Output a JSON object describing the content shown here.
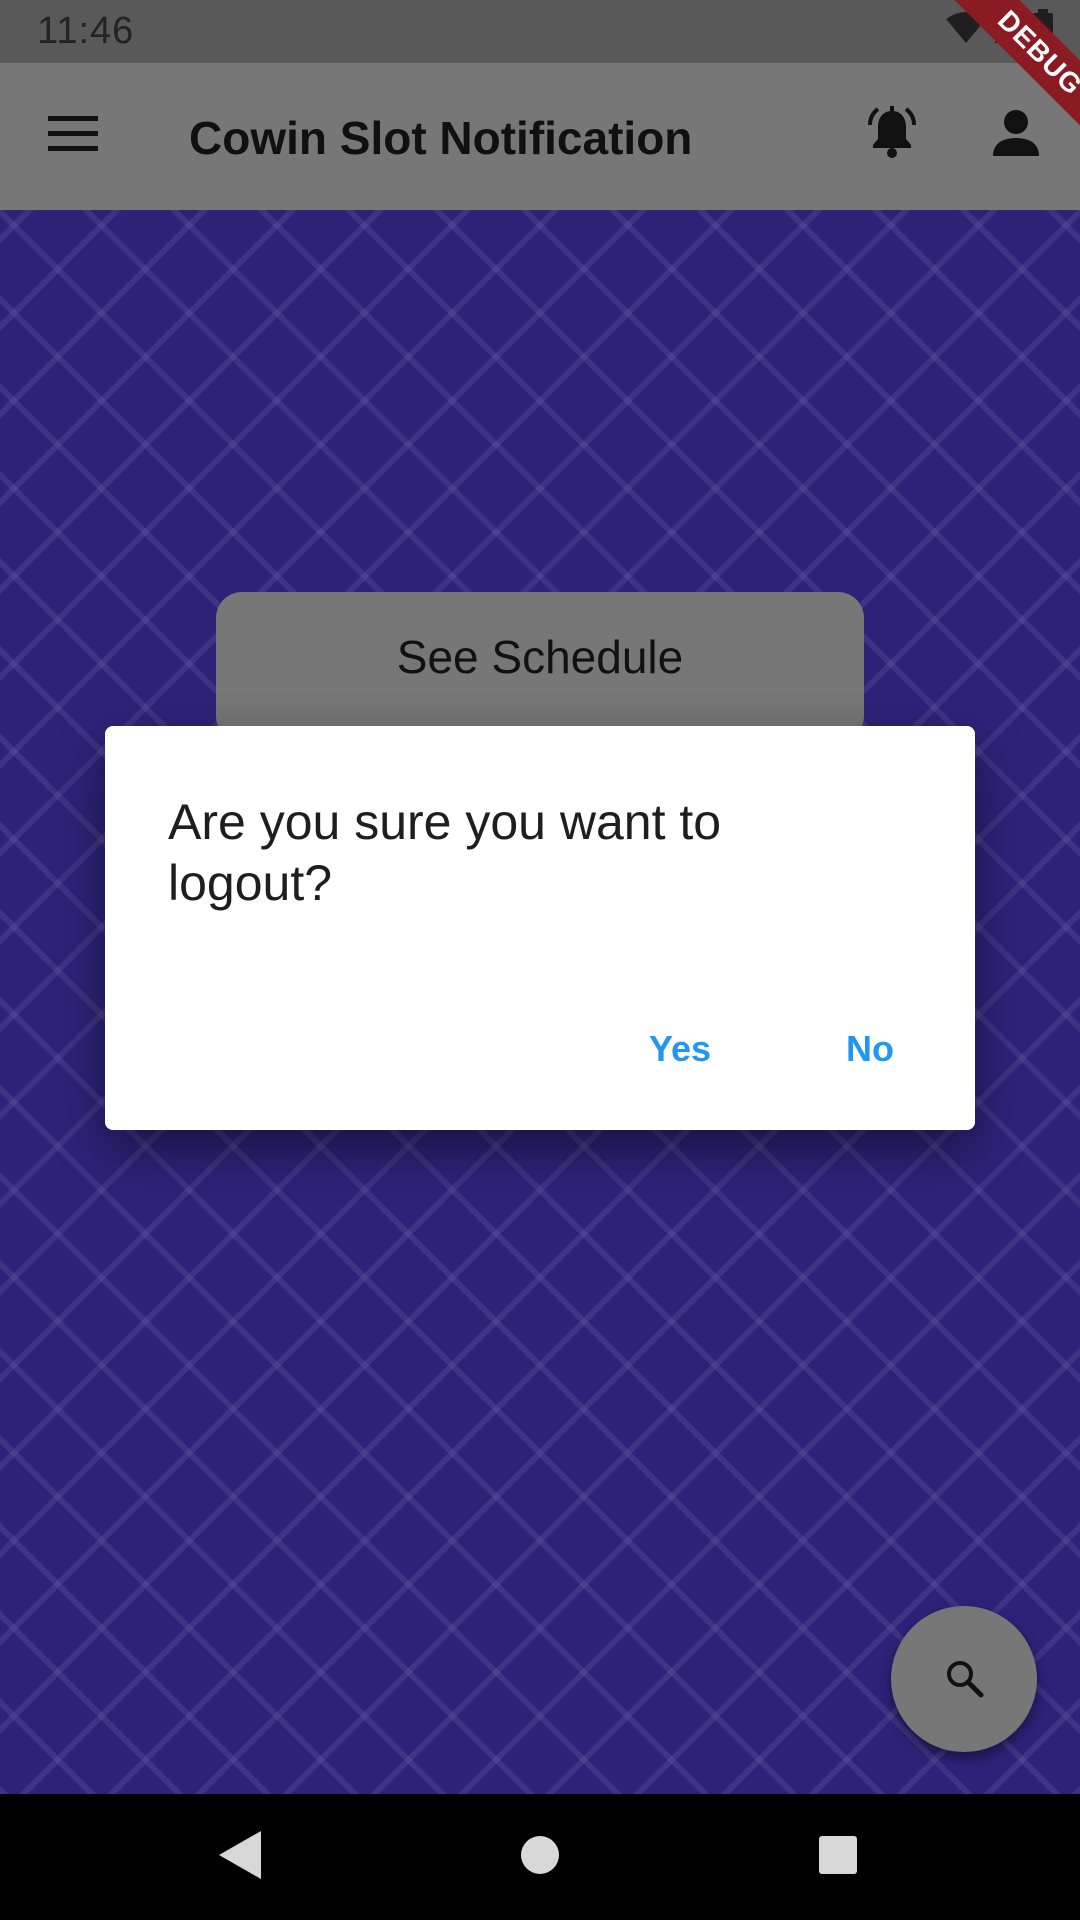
{
  "status_bar": {
    "time": "11:46",
    "icons": [
      "wifi-icon",
      "signal-icon",
      "battery-icon"
    ]
  },
  "debug_banner": {
    "label": "DEBUG",
    "color": "#8b1b22"
  },
  "app_bar": {
    "title": "Cowin Slot Notification",
    "icons": [
      "menu-icon",
      "bell-icon",
      "person-icon"
    ],
    "color": "#777777"
  },
  "main": {
    "see_schedule_label": "See Schedule",
    "background_color": "#2c2379"
  },
  "dialog": {
    "title": "Are you sure you want to logout?",
    "yes_label": "Yes",
    "no_label": "No",
    "accent": "#2196f3"
  },
  "fab": {
    "icon": "search-icon"
  },
  "nav_bar": {
    "icons": [
      "back-icon",
      "home-icon",
      "recents-icon"
    ]
  }
}
